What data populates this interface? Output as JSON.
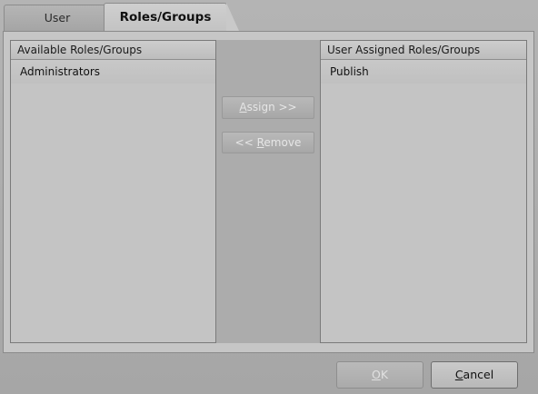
{
  "tabs": [
    {
      "label": "User",
      "active": false
    },
    {
      "label": "Roles/Groups",
      "active": true
    }
  ],
  "available": {
    "header": "Available Roles/Groups",
    "items": [
      "Administrators"
    ]
  },
  "assigned": {
    "header": "User Assigned Roles/Groups",
    "items": [
      "Publish"
    ]
  },
  "buttons": {
    "assign_mnemonic": "A",
    "assign_rest": "ssign >>",
    "remove_prefix": "<< ",
    "remove_mnemonic": "R",
    "remove_rest": "emove",
    "ok_mnemonic": "O",
    "ok_rest": "K",
    "cancel_mnemonic": "C",
    "cancel_rest": "ancel"
  },
  "colors": {
    "dialog_bg": "#aaaaaa",
    "panel_bg": "#c6c6c6",
    "disabled_text": "#e6e6e6"
  }
}
